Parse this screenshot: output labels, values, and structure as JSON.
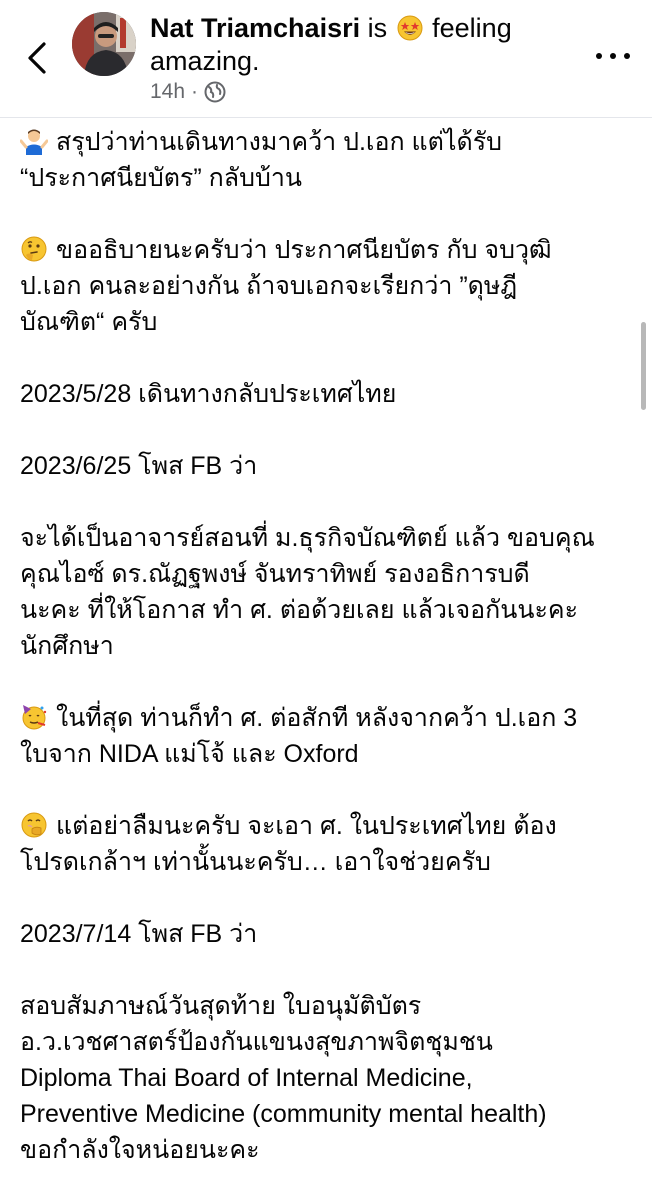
{
  "header": {
    "author": "Nat Triamchaisri",
    "status_prefix": "is",
    "status_suffix": "feeling",
    "feeling_line2": "amazing.",
    "time": "14h",
    "icons": {
      "back": "chevron-left-icon",
      "more": "more-horizontal-icon",
      "privacy": "globe-icon",
      "feeling": "star-struck-emoji-icon"
    }
  },
  "post": {
    "paragraphs": [
      {
        "emoji": "person-shrugging",
        "lines": [
          "สรุปว่าท่านเดินทางมาคว้า ป.เอก แต่ได้รับ",
          "“ประกาศนียบัตร” กลับบ้าน"
        ]
      },
      {
        "emoji": "thinking-face",
        "lines": [
          "ขออธิบายนะครับว่า ประกาศนียบัตร กับ จบวุฒิ",
          "ป.เอก คนละอย่างกัน ถ้าจบเอกจะเรียกว่า ”ดุษฎี",
          "บัณฑิต“ ครับ"
        ]
      },
      {
        "emoji": "",
        "lines": [
          "2023/5/28 เดินทางกลับประเทศไทย"
        ]
      },
      {
        "emoji": "",
        "lines": [
          "2023/6/25 โพส FB ว่า"
        ]
      },
      {
        "emoji": "",
        "lines": [
          "จะได้เป็นอาจารย์สอนที่ ม.ธุรกิจบัณฑิตย์ แล้ว ขอบคุณ",
          "คุณไอซ์ ดร.ณัฏฐพงษ์ จันทราทิพย์ รองอธิการบดี",
          "นะคะ ที่ให้โอกาส ทำ ศ. ต่อด้วยเลย แล้วเจอกันนะคะ",
          "นักศึกษา"
        ]
      },
      {
        "emoji": "partying-face",
        "lines": [
          "ในที่สุด ท่านก็ทำ ศ. ต่อสักที หลังจากคว้า ป.เอก 3",
          "ใบจาก NIDA แม่โจ้ และ Oxford"
        ]
      },
      {
        "emoji": "face-with-hand-over-mouth",
        "lines": [
          "แต่อย่าลืมนะครับ จะเอา ศ. ในประเทศไทย ต้อง",
          "โปรดเกล้าฯ เท่านั้นนะครับ… เอาใจช่วยครับ"
        ]
      },
      {
        "emoji": "",
        "lines": [
          "2023/7/14 โพส FB ว่า"
        ]
      },
      {
        "emoji": "",
        "lines": [
          "สอบสัมภาษณ์วันสุดท้าย ใบอนุมัติบัตร",
          "อ.ว.เวชศาสตร์ป้องกันแขนงสุขภาพจิตชุมชน",
          "Diploma Thai Board of Internal Medicine,",
          "Preventive Medicine (community mental health)",
          "ขอกำลังใจหน่อยนะคะ"
        ]
      }
    ]
  }
}
